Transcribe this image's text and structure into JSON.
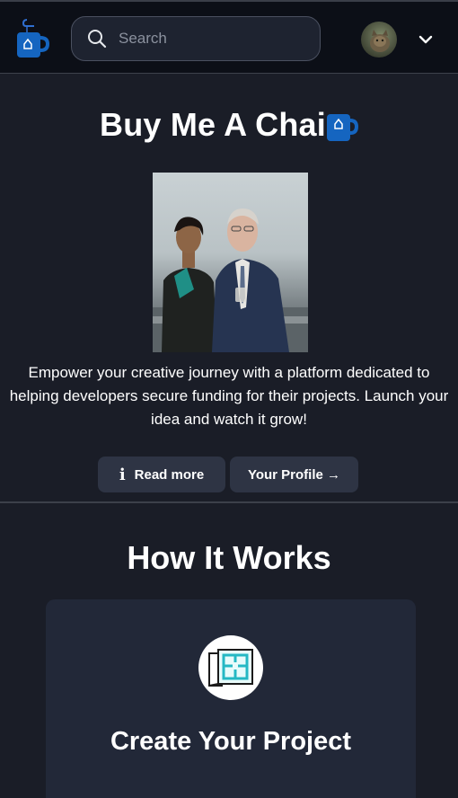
{
  "header": {
    "logo_icon": "tea-cup-icon",
    "search": {
      "placeholder": "Search",
      "value": ""
    },
    "avatar_icon": "user-avatar",
    "menu_icon": "chevron-down-icon"
  },
  "hero": {
    "title": "Buy Me A Chai",
    "title_icon": "tea-cup-icon",
    "description": "Empower your creative journey with a platform dedicated to helping developers secure funding for their projects. Launch your idea and watch it grow!",
    "buttons": {
      "read_more": "Read more",
      "read_more_icon": "info-icon",
      "profile": "Your Profile →"
    }
  },
  "how_it_works": {
    "title": "How It Works",
    "cards": [
      {
        "icon": "blueprint-icon",
        "title": "Create Your Project"
      }
    ]
  },
  "colors": {
    "background": "#1a1d27",
    "header": "#0c0f17",
    "brand_blue": "#1565c0",
    "button": "#2e3444",
    "card": "#222838"
  }
}
